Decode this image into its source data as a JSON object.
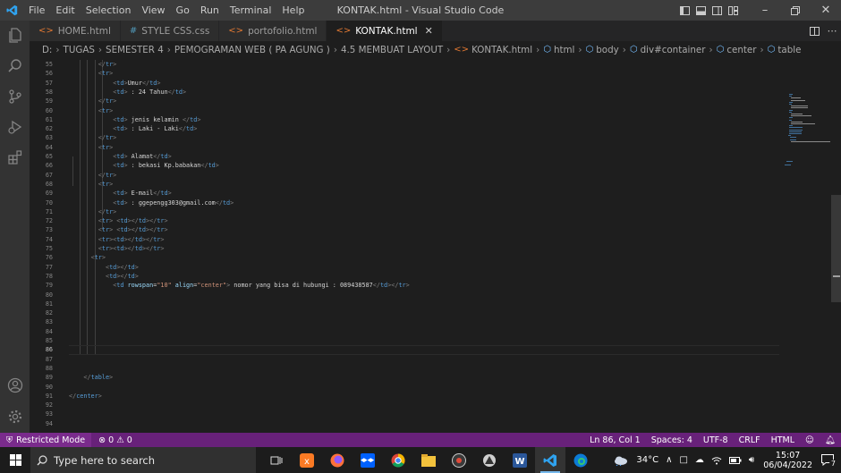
{
  "window": {
    "title": "KONTAK.html - Visual Studio Code",
    "menu": [
      "File",
      "Edit",
      "Selection",
      "View",
      "Go",
      "Run",
      "Terminal",
      "Help"
    ]
  },
  "tabs": [
    {
      "label": "HOME.html",
      "type": "html",
      "active": false
    },
    {
      "label": "STYLE CSS.css",
      "type": "css",
      "active": false
    },
    {
      "label": "portofolio.html",
      "type": "html",
      "active": false
    },
    {
      "label": "KONTAK.html",
      "type": "html",
      "active": true
    }
  ],
  "breadcrumb": [
    "D:",
    "TUGAS",
    "SEMESTER 4",
    "PEMOGRAMAN WEB ( PA AGUNG )",
    "4.5 MEMBUAT LAYOUT",
    "KONTAK.html",
    "html",
    "body",
    "div#container",
    "center",
    "table"
  ],
  "editor": {
    "current_line": "86",
    "lines": [
      {
        "n": "55",
        "indent": 4,
        "tokens": [
          [
            "tg",
            "</"
          ],
          [
            "tn",
            "tr"
          ],
          [
            "tg",
            ">"
          ]
        ]
      },
      {
        "n": "56",
        "indent": 4,
        "tokens": [
          [
            "tg",
            "<"
          ],
          [
            "tn",
            "tr"
          ],
          [
            "tg",
            ">"
          ]
        ]
      },
      {
        "n": "57",
        "indent": 6,
        "tokens": [
          [
            "tg",
            "<"
          ],
          [
            "tn",
            "td"
          ],
          [
            "tg",
            ">"
          ],
          [
            "tx",
            "Umur"
          ],
          [
            "tg",
            "</"
          ],
          [
            "tn",
            "td"
          ],
          [
            "tg",
            ">"
          ]
        ]
      },
      {
        "n": "58",
        "indent": 6,
        "tokens": [
          [
            "tg",
            "<"
          ],
          [
            "tn",
            "td"
          ],
          [
            "tg",
            ">"
          ],
          [
            "tx",
            " : 24 Tahun"
          ],
          [
            "tg",
            "</"
          ],
          [
            "tn",
            "td"
          ],
          [
            "tg",
            ">"
          ]
        ]
      },
      {
        "n": "59",
        "indent": 4,
        "tokens": [
          [
            "tg",
            "</"
          ],
          [
            "tn",
            "tr"
          ],
          [
            "tg",
            ">"
          ]
        ]
      },
      {
        "n": "60",
        "indent": 4,
        "tokens": [
          [
            "tg",
            "<"
          ],
          [
            "tn",
            "tr"
          ],
          [
            "tg",
            ">"
          ]
        ]
      },
      {
        "n": "61",
        "indent": 6,
        "tokens": [
          [
            "tg",
            "<"
          ],
          [
            "tn",
            "td"
          ],
          [
            "tg",
            ">"
          ],
          [
            "tx",
            " jenis kelamin "
          ],
          [
            "tg",
            "</"
          ],
          [
            "tn",
            "td"
          ],
          [
            "tg",
            ">"
          ]
        ]
      },
      {
        "n": "62",
        "indent": 6,
        "tokens": [
          [
            "tg",
            "<"
          ],
          [
            "tn",
            "td"
          ],
          [
            "tg",
            ">"
          ],
          [
            "tx",
            " : Laki - Laki"
          ],
          [
            "tg",
            "</"
          ],
          [
            "tn",
            "td"
          ],
          [
            "tg",
            ">"
          ]
        ]
      },
      {
        "n": "63",
        "indent": 4,
        "tokens": [
          [
            "tg",
            "</"
          ],
          [
            "tn",
            "tr"
          ],
          [
            "tg",
            ">"
          ]
        ]
      },
      {
        "n": "64",
        "indent": 4,
        "tokens": [
          [
            "tg",
            "<"
          ],
          [
            "tn",
            "tr"
          ],
          [
            "tg",
            ">"
          ]
        ]
      },
      {
        "n": "65",
        "indent": 6,
        "tokens": [
          [
            "tg",
            "<"
          ],
          [
            "tn",
            "td"
          ],
          [
            "tg",
            ">"
          ],
          [
            "tx",
            " Alamat"
          ],
          [
            "tg",
            "</"
          ],
          [
            "tn",
            "td"
          ],
          [
            "tg",
            ">"
          ]
        ]
      },
      {
        "n": "66",
        "indent": 6,
        "tokens": [
          [
            "tg",
            "<"
          ],
          [
            "tn",
            "td"
          ],
          [
            "tg",
            ">"
          ],
          [
            "tx",
            " : bekasi Kp.babakan"
          ],
          [
            "tg",
            "</"
          ],
          [
            "tn",
            "td"
          ],
          [
            "tg",
            ">"
          ]
        ]
      },
      {
        "n": "67",
        "indent": 4,
        "tokens": [
          [
            "tg",
            "</"
          ],
          [
            "tn",
            "tr"
          ],
          [
            "tg",
            ">"
          ]
        ]
      },
      {
        "n": "68",
        "indent": 4,
        "tokens": [
          [
            "tg",
            "<"
          ],
          [
            "tn",
            "tr"
          ],
          [
            "tg",
            ">"
          ]
        ]
      },
      {
        "n": "69",
        "indent": 6,
        "tokens": [
          [
            "tg",
            "<"
          ],
          [
            "tn",
            "td"
          ],
          [
            "tg",
            ">"
          ],
          [
            "tx",
            " E-mail"
          ],
          [
            "tg",
            "</"
          ],
          [
            "tn",
            "td"
          ],
          [
            "tg",
            ">"
          ]
        ]
      },
      {
        "n": "70",
        "indent": 6,
        "tokens": [
          [
            "tg",
            "<"
          ],
          [
            "tn",
            "td"
          ],
          [
            "tg",
            ">"
          ],
          [
            "tx",
            " : ggepengg303@gmail.com"
          ],
          [
            "tg",
            "</"
          ],
          [
            "tn",
            "td"
          ],
          [
            "tg",
            ">"
          ]
        ]
      },
      {
        "n": "71",
        "indent": 4,
        "tokens": [
          [
            "tg",
            "</"
          ],
          [
            "tn",
            "tr"
          ],
          [
            "tg",
            ">"
          ]
        ]
      },
      {
        "n": "72",
        "indent": 4,
        "tokens": [
          [
            "tg",
            "<"
          ],
          [
            "tn",
            "tr"
          ],
          [
            "tg",
            ">"
          ],
          [
            "tx",
            " "
          ],
          [
            "tg",
            "<"
          ],
          [
            "tn",
            "td"
          ],
          [
            "tg",
            "></"
          ],
          [
            "tn",
            "td"
          ],
          [
            "tg",
            "></"
          ],
          [
            "tn",
            "tr"
          ],
          [
            "tg",
            ">"
          ]
        ]
      },
      {
        "n": "73",
        "indent": 4,
        "tokens": [
          [
            "tg",
            "<"
          ],
          [
            "tn",
            "tr"
          ],
          [
            "tg",
            ">"
          ],
          [
            "tx",
            " "
          ],
          [
            "tg",
            "<"
          ],
          [
            "tn",
            "td"
          ],
          [
            "tg",
            "></"
          ],
          [
            "tn",
            "td"
          ],
          [
            "tg",
            "></"
          ],
          [
            "tn",
            "tr"
          ],
          [
            "tg",
            ">"
          ]
        ]
      },
      {
        "n": "74",
        "indent": 4,
        "tokens": [
          [
            "tg",
            "<"
          ],
          [
            "tn",
            "tr"
          ],
          [
            "tg",
            "><"
          ],
          [
            "tn",
            "td"
          ],
          [
            "tg",
            "></"
          ],
          [
            "tn",
            "td"
          ],
          [
            "tg",
            "></"
          ],
          [
            "tn",
            "tr"
          ],
          [
            "tg",
            ">"
          ]
        ]
      },
      {
        "n": "75",
        "indent": 4,
        "tokens": [
          [
            "tg",
            "<"
          ],
          [
            "tn",
            "tr"
          ],
          [
            "tg",
            "><"
          ],
          [
            "tn",
            "td"
          ],
          [
            "tg",
            "></"
          ],
          [
            "tn",
            "td"
          ],
          [
            "tg",
            "></"
          ],
          [
            "tn",
            "tr"
          ],
          [
            "tg",
            ">"
          ]
        ]
      },
      {
        "n": "76",
        "indent": 3,
        "tokens": [
          [
            "tg",
            "<"
          ],
          [
            "tn",
            "tr"
          ],
          [
            "tg",
            ">"
          ]
        ]
      },
      {
        "n": "77",
        "indent": 5,
        "tokens": [
          [
            "tg",
            "<"
          ],
          [
            "tn",
            "td"
          ],
          [
            "tg",
            "></"
          ],
          [
            "tn",
            "td"
          ],
          [
            "tg",
            ">"
          ]
        ]
      },
      {
        "n": "78",
        "indent": 5,
        "tokens": [
          [
            "tg",
            "<"
          ],
          [
            "tn",
            "td"
          ],
          [
            "tg",
            "></"
          ],
          [
            "tn",
            "td"
          ],
          [
            "tg",
            ">"
          ]
        ]
      },
      {
        "n": "79",
        "indent": 6,
        "tokens": [
          [
            "tg",
            "<"
          ],
          [
            "tn",
            "td"
          ],
          [
            "tx",
            " "
          ],
          [
            "at",
            "rowspan"
          ],
          [
            "tx",
            "="
          ],
          [
            "av",
            "\"10\""
          ],
          [
            "tx",
            " "
          ],
          [
            "at",
            "align"
          ],
          [
            "tx",
            "="
          ],
          [
            "av",
            "\"center\""
          ],
          [
            "tg",
            ">"
          ],
          [
            "tx",
            " nomor yang bisa di hubungi : 089438587"
          ],
          [
            "tg",
            "</"
          ],
          [
            "tn",
            "td"
          ],
          [
            "tg",
            "></"
          ],
          [
            "tn",
            "tr"
          ],
          [
            "tg",
            ">"
          ]
        ]
      },
      {
        "n": "80",
        "indent": 0,
        "tokens": []
      },
      {
        "n": "81",
        "indent": 0,
        "tokens": []
      },
      {
        "n": "82",
        "indent": 0,
        "tokens": []
      },
      {
        "n": "83",
        "indent": 0,
        "tokens": []
      },
      {
        "n": "84",
        "indent": 0,
        "tokens": []
      },
      {
        "n": "85",
        "indent": 0,
        "tokens": []
      },
      {
        "n": "86",
        "indent": 0,
        "tokens": []
      },
      {
        "n": "87",
        "indent": 0,
        "tokens": []
      },
      {
        "n": "88",
        "indent": 0,
        "tokens": []
      },
      {
        "n": "89",
        "indent": 2,
        "tokens": [
          [
            "tg",
            "</"
          ],
          [
            "tn",
            "table"
          ],
          [
            "tg",
            ">"
          ]
        ]
      },
      {
        "n": "90",
        "indent": 0,
        "tokens": []
      },
      {
        "n": "91",
        "indent": 0,
        "tokens": [
          [
            "tg",
            "</"
          ],
          [
            "tn",
            "center"
          ],
          [
            "tg",
            ">"
          ]
        ]
      },
      {
        "n": "92",
        "indent": 0,
        "tokens": []
      },
      {
        "n": "93",
        "indent": 0,
        "tokens": []
      },
      {
        "n": "94",
        "indent": 0,
        "tokens": []
      }
    ]
  },
  "status": {
    "restricted": "Restricted Mode",
    "errors": "0",
    "warnings": "0",
    "position": "Ln 86, Col 1",
    "spaces": "Spaces: 4",
    "encoding": "UTF-8",
    "eol": "CRLF",
    "language": "HTML"
  },
  "taskbar": {
    "search_placeholder": "Type here to search",
    "temperature": "34°C",
    "time": "15:07",
    "date": "06/04/2022",
    "notification_count": "7"
  },
  "colors": {
    "status_bar": "#68217a",
    "editor_bg": "#1e1e1e",
    "tag": "#569cd6",
    "attribute": "#9cdcfe",
    "attr_value": "#ce9178"
  }
}
